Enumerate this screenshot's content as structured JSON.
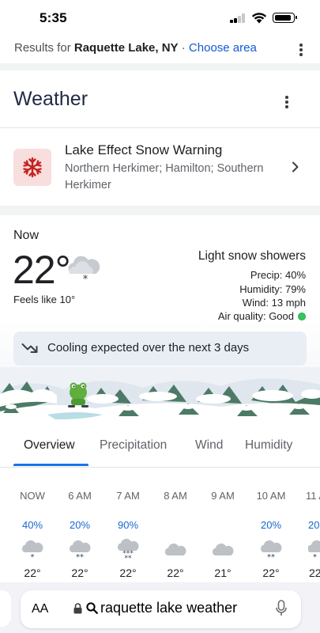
{
  "status_bar": {
    "time": "5:35"
  },
  "results": {
    "prefix": "Results for ",
    "location": "Raquette Lake, NY",
    "sep": " · ",
    "choose_area": "Choose area"
  },
  "weather": {
    "title": "Weather"
  },
  "alert": {
    "title": "Lake Effect Snow Warning",
    "areas": "Northern Herkimer; Hamilton; Southern Herkimer",
    "icon": "snowflake-icon",
    "icon_bg": "#f8dedd",
    "icon_color": "#c5221f"
  },
  "current": {
    "label": "Now",
    "temp": "22°",
    "feels_like": "Feels like 10°",
    "condition": "Light snow showers",
    "precip": "Precip: 40%",
    "humidity": "Humidity: 79%",
    "wind": "Wind: 13 mph",
    "air_quality": "Air quality: Good",
    "air_quality_color": "#34c759",
    "trend": "Cooling expected over the next 3 days"
  },
  "tabs": [
    {
      "label": "Overview",
      "active": true
    },
    {
      "label": "Precipitation",
      "active": false
    },
    {
      "label": "Wind",
      "active": false
    },
    {
      "label": "Humidity",
      "active": false
    }
  ],
  "hourly": [
    {
      "time": "NOW",
      "precip": "40%",
      "icon": "snow-cloud-icon",
      "temp": "22°"
    },
    {
      "time": "6 AM",
      "precip": "20%",
      "icon": "snow-cloud-icon",
      "temp": "22°"
    },
    {
      "time": "7 AM",
      "precip": "90%",
      "icon": "heavy-snow-cloud-icon",
      "temp": "22°"
    },
    {
      "time": "8 AM",
      "precip": "",
      "icon": "cloud-icon",
      "temp": "22°"
    },
    {
      "time": "9 AM",
      "precip": "",
      "icon": "cloud-icon",
      "temp": "21°"
    },
    {
      "time": "10 AM",
      "precip": "20%",
      "icon": "snow-cloud-icon",
      "temp": "22°"
    },
    {
      "time": "11 A",
      "precip": "20",
      "icon": "snow-cloud-icon",
      "temp": "22"
    }
  ],
  "browser": {
    "text_size": "AA",
    "query": "raquette lake weather"
  },
  "colors": {
    "accent": "#1a73e8",
    "precip": "#1967d2",
    "link": "#1558d6"
  }
}
